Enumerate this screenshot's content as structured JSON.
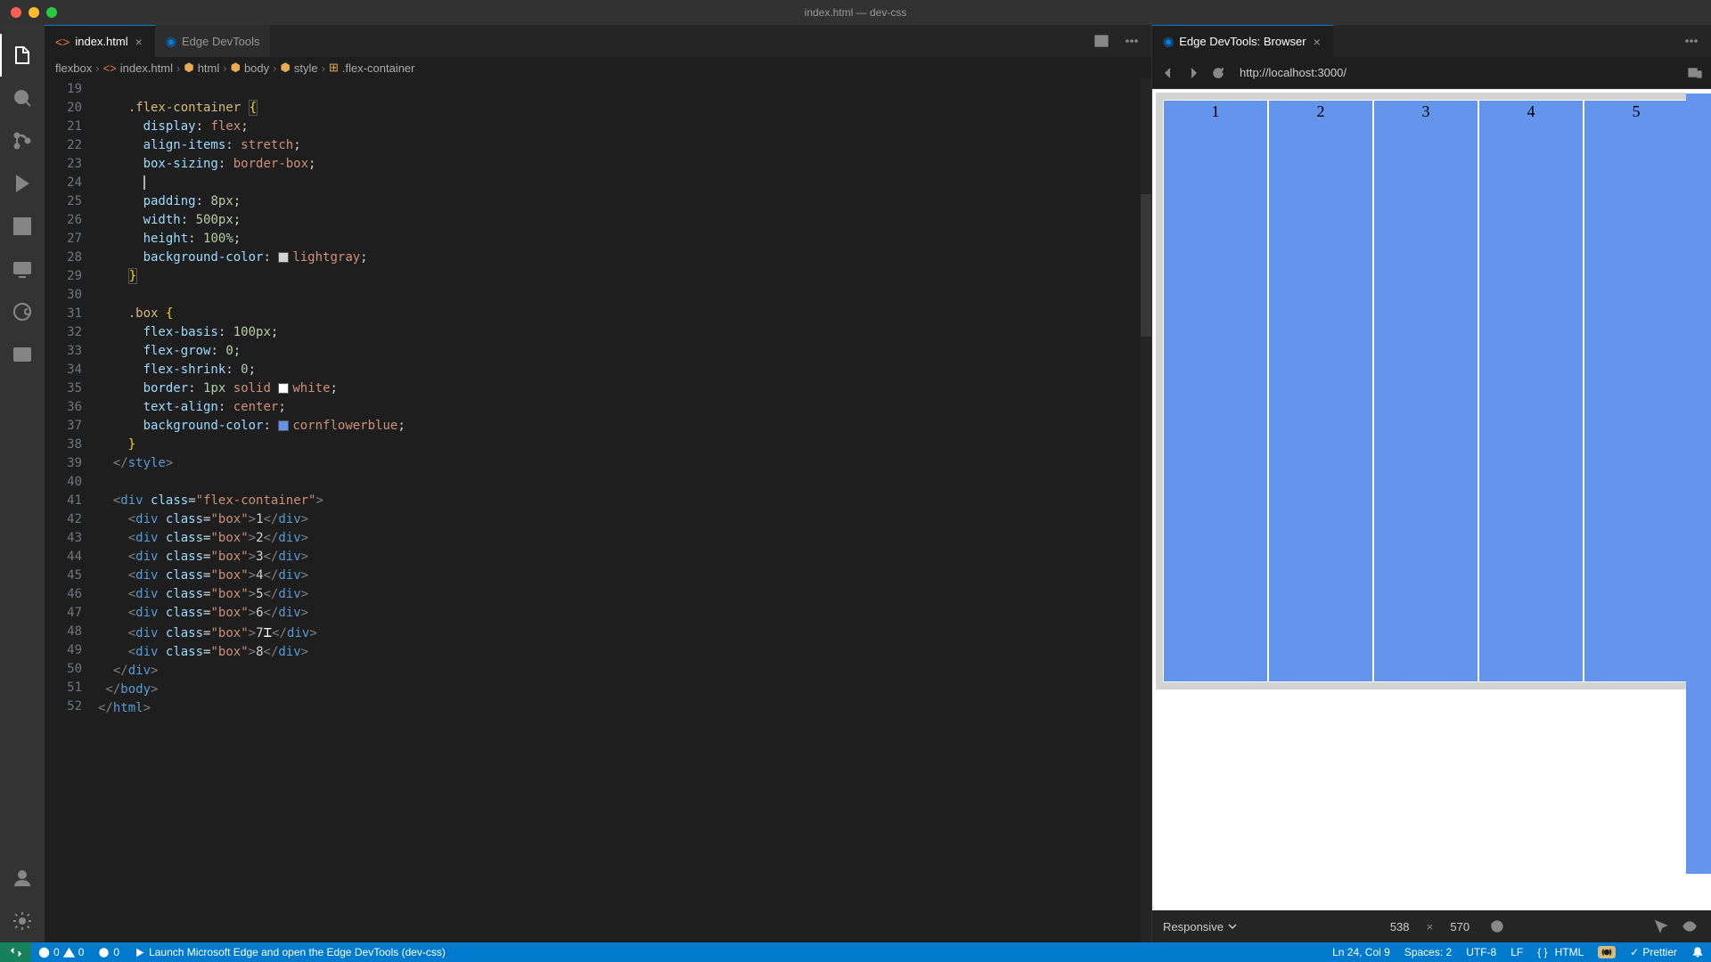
{
  "window": {
    "title": "index.html — dev-css"
  },
  "tabs": [
    {
      "label": "index.html",
      "icon": "<>",
      "icon_color": "#e37933"
    },
    {
      "label": "Edge DevTools",
      "icon_color": "#0078d4"
    }
  ],
  "devtools_tab": {
    "label": "Edge DevTools: Browser"
  },
  "breadcrumb": {
    "parts": [
      "flexbox",
      "index.html",
      "html",
      "body",
      "style",
      ".flex-container"
    ]
  },
  "url": "http://localhost:3000/",
  "line_numbers": [
    19,
    20,
    21,
    22,
    23,
    24,
    25,
    26,
    27,
    28,
    29,
    30,
    31,
    32,
    33,
    34,
    35,
    36,
    37,
    38,
    39,
    40,
    41,
    42,
    43,
    44,
    45,
    46,
    47,
    48,
    49,
    50,
    51,
    52
  ],
  "code": {
    "l20_sel": ".flex-container",
    "l21_prop": "display",
    "l21_val": "flex",
    "l22_prop": "align-items",
    "l22_val": "stretch",
    "l23_prop": "box-sizing",
    "l23_val": "border-box",
    "l25_prop": "padding",
    "l25_val": "8px",
    "l26_prop": "width",
    "l26_val": "500px",
    "l27_prop": "height",
    "l27_val": "100%",
    "l28_prop": "background-color",
    "l28_val": "lightgray",
    "l31_sel": ".box",
    "l32_prop": "flex-basis",
    "l32_val": "100px",
    "l33_prop": "flex-grow",
    "l33_val": "0",
    "l34_prop": "flex-shrink",
    "l34_val": "0",
    "l35_prop": "border",
    "l35_val_a": "1px",
    "l35_val_b": "solid",
    "l35_val_c": "white",
    "l36_prop": "text-align",
    "l36_val": "center",
    "l37_prop": "background-color",
    "l37_val": "cornflowerblue",
    "l39_tag": "style",
    "l41_tag": "div",
    "l41_attr": "class",
    "l41_class": "flex-container",
    "box_tag": "div",
    "box_attr": "class",
    "box_class": "box",
    "boxes": [
      "1",
      "2",
      "3",
      "4",
      "5",
      "6",
      "7",
      "8"
    ],
    "l50_tag": "div",
    "l51_tag": "body",
    "l52_tag": "html"
  },
  "demo_boxes": [
    "1",
    "2",
    "3",
    "4",
    "5"
  ],
  "device": {
    "mode": "Responsive",
    "width": "538",
    "height": "570"
  },
  "statusbar": {
    "errors": "0",
    "warnings": "0",
    "port": "0",
    "launch": "Launch Microsoft Edge and open the Edge DevTools (dev-css)",
    "cursor": "Ln 24, Col 9",
    "spaces": "Spaces: 2",
    "encoding": "UTF-8",
    "eol": "LF",
    "lang": "HTML",
    "prettier": "Prettier"
  }
}
